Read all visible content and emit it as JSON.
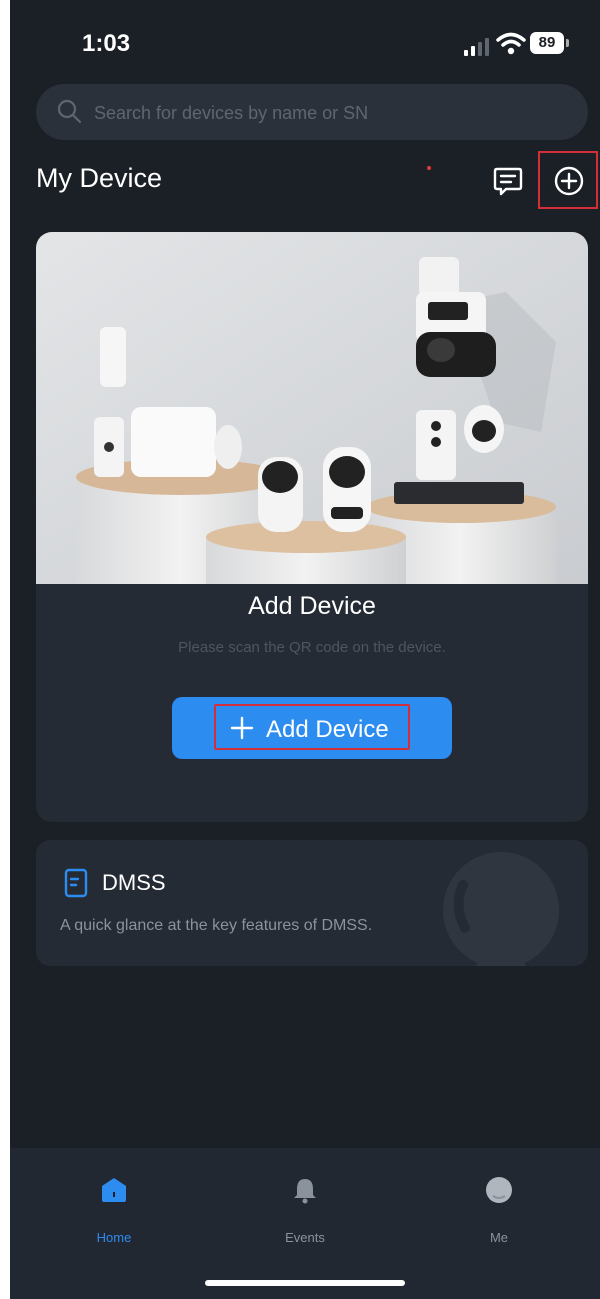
{
  "status_bar": {
    "time": "1:03",
    "battery": "89"
  },
  "search": {
    "placeholder": "Search for devices by name or SN",
    "value": ""
  },
  "header": {
    "title": "My Device"
  },
  "add_card": {
    "title": "Add Device",
    "subtitle": "Please scan the QR code on the device.",
    "button_label": "Add Device"
  },
  "dmss_card": {
    "title": "DMSS",
    "description": "A quick glance at the key features of DMSS."
  },
  "tabbar": {
    "tabs": [
      {
        "label": "Home",
        "icon": "home-icon",
        "active": true
      },
      {
        "label": "Events",
        "icon": "bell-icon",
        "active": false
      },
      {
        "label": "Me",
        "icon": "user-icon",
        "active": false
      }
    ]
  },
  "colors": {
    "background": "#1b1f26",
    "card": "#252b34",
    "accent": "#2d8cf0",
    "highlight": "#d32f3a"
  }
}
